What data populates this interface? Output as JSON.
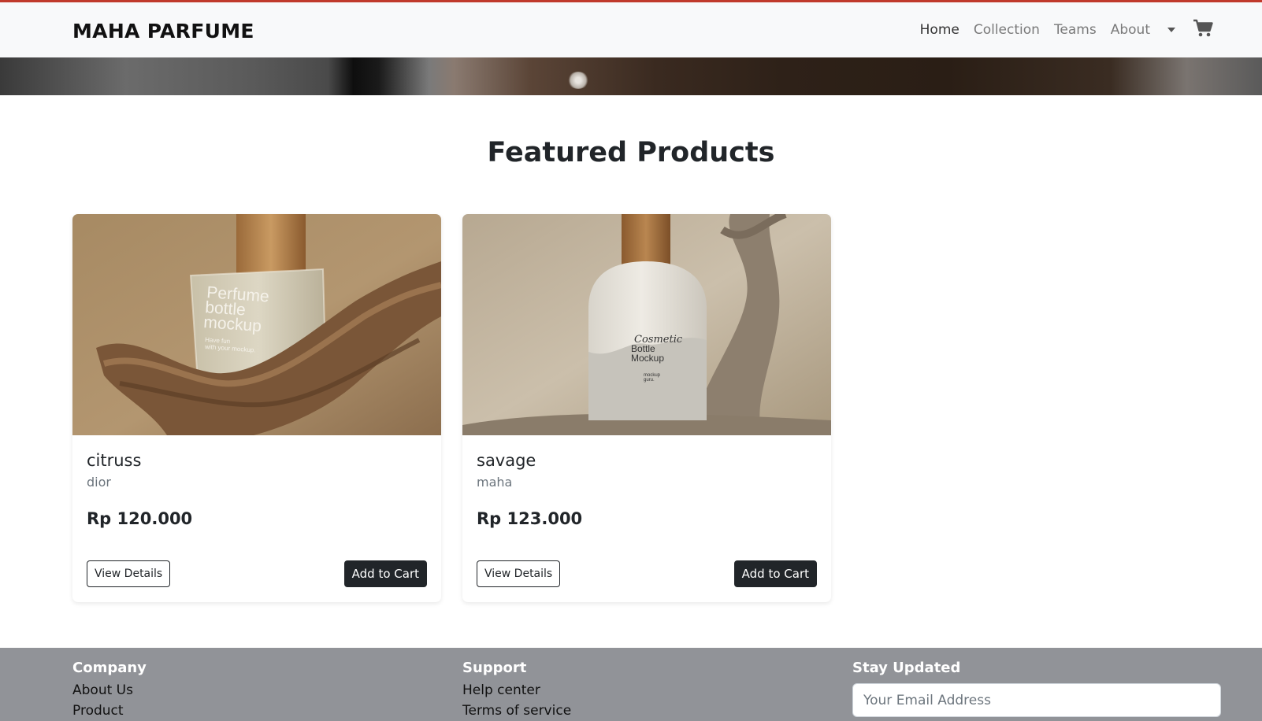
{
  "header": {
    "brand": "MAHA PARFUME",
    "nav": [
      {
        "label": "Home",
        "active": true
      },
      {
        "label": "Collection",
        "active": false
      },
      {
        "label": "Teams",
        "active": false
      },
      {
        "label": "About",
        "active": false
      }
    ],
    "accent_color": "#c0392b"
  },
  "main": {
    "section_title": "Featured Products",
    "products": [
      {
        "name": "citruss",
        "brand": "dior",
        "price": "Rp 120.000",
        "view_label": "View Details",
        "cart_label": "Add to Cart",
        "bottle_label": [
          "Perfume",
          "bottle",
          "mockup"
        ],
        "bottle_sub": [
          "Have fun",
          "with your mockup."
        ],
        "image_icon": "perfume-bottle-mockup-image"
      },
      {
        "name": "savage",
        "brand": "maha",
        "price": "Rp 123.000",
        "view_label": "View Details",
        "cart_label": "Add to Cart",
        "bottle_label": [
          "Cosmetic",
          "Bottle",
          "Mockup"
        ],
        "bottle_sub": [
          "mockup",
          "guru."
        ],
        "image_icon": "cosmetic-bottle-mockup-image"
      }
    ]
  },
  "footer": {
    "company": {
      "title": "Company",
      "links": [
        "About Us",
        "Product"
      ]
    },
    "support": {
      "title": "Support",
      "links": [
        "Help center",
        "Terms of service"
      ]
    },
    "newsletter": {
      "title": "Stay Updated",
      "email_placeholder": "Your Email Address"
    },
    "background_color": "#919398"
  }
}
